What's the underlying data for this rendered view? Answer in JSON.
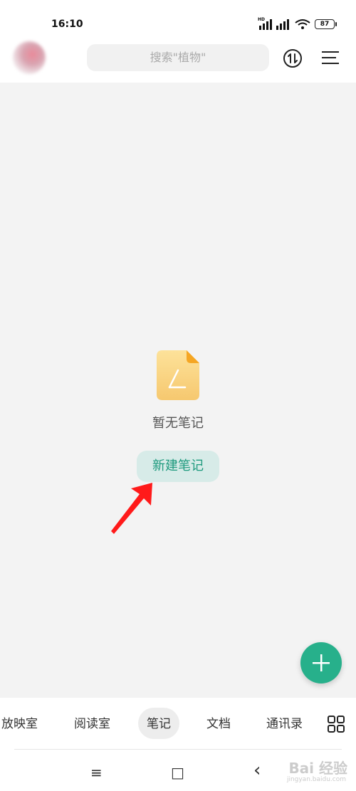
{
  "status": {
    "time": "16:10",
    "hd": "HD",
    "battery": "87"
  },
  "top_bar": {
    "search_placeholder": "搜索\"植物\"",
    "avatar": "avatar",
    "sync_icon": "sync-icon",
    "menu_icon": "menu-icon"
  },
  "main": {
    "empty_state_text": "暂无笔记",
    "new_note_label": "新建笔记",
    "empty_icon": "note-document-icon",
    "fab_icon": "plus-icon"
  },
  "nav": {
    "tabs": [
      {
        "label": "放映室",
        "active": false
      },
      {
        "label": "阅读室",
        "active": false
      },
      {
        "label": "笔记",
        "active": true
      },
      {
        "label": "文档",
        "active": false
      },
      {
        "label": "通讯录",
        "active": false
      }
    ],
    "more_icon": "grid-icon"
  },
  "system_nav": {
    "menu": "≡",
    "home": "□",
    "back": "‹"
  },
  "watermark": {
    "brand": "Bai 经验",
    "url": "jingyan.baidu.com"
  },
  "colors": {
    "accent": "#27b08b",
    "button_bg": "#d7ebe8",
    "button_text": "#1e9a7e",
    "arrow": "#ff1a1a"
  }
}
